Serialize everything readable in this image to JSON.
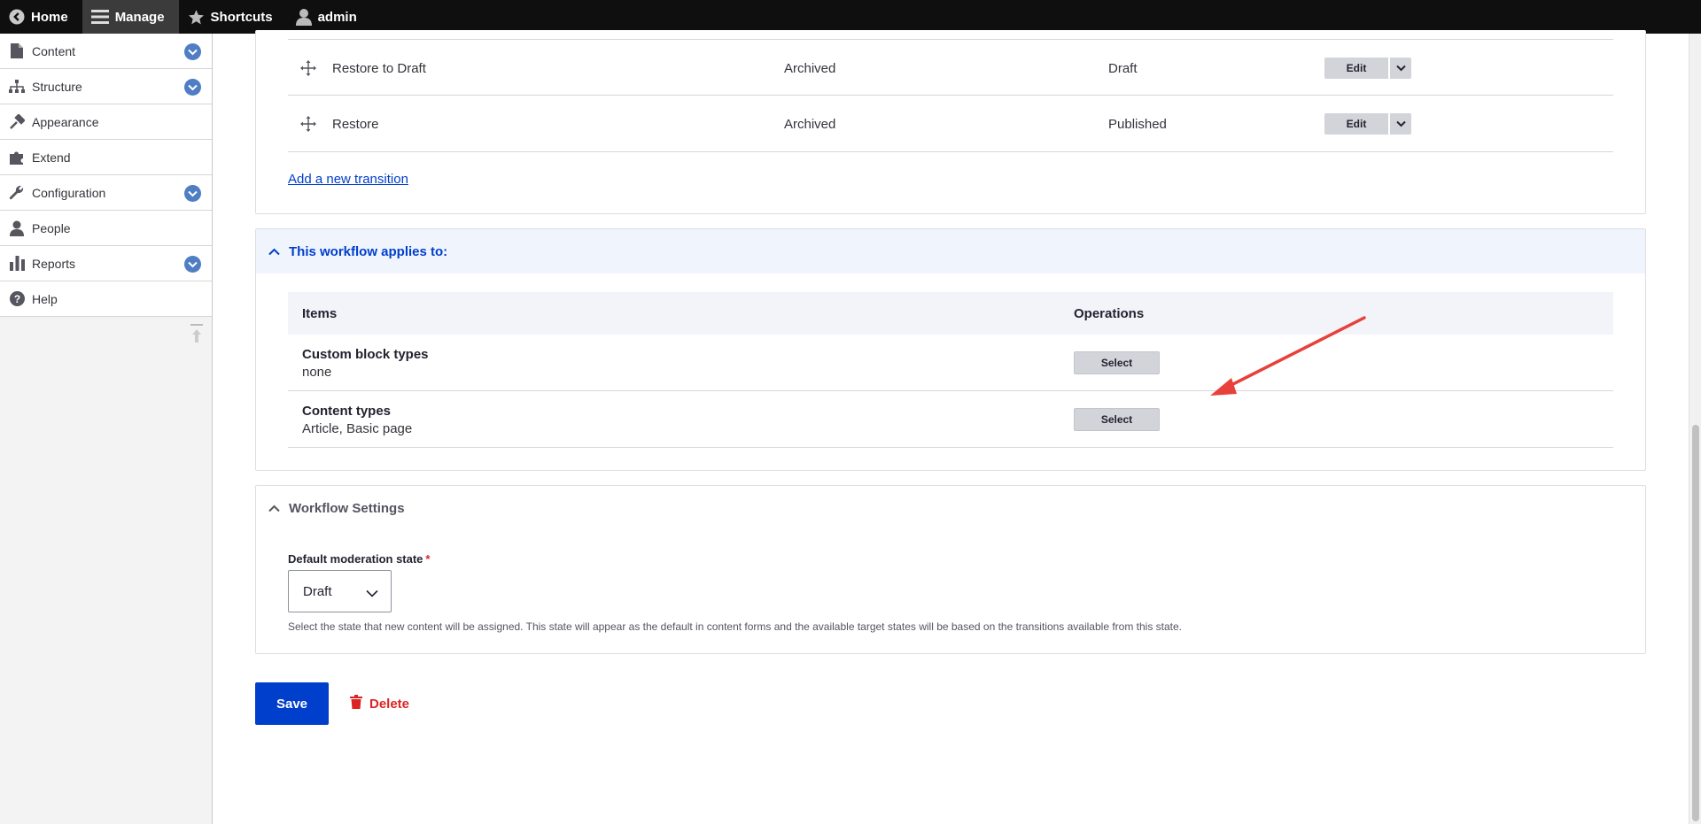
{
  "toolbar": {
    "home": "Home",
    "manage": "Manage",
    "shortcuts": "Shortcuts",
    "user": "admin"
  },
  "sidebar": {
    "items": [
      {
        "label": "Content",
        "icon": "file-icon",
        "expandable": true
      },
      {
        "label": "Structure",
        "icon": "sitemap-icon",
        "expandable": true
      },
      {
        "label": "Appearance",
        "icon": "paintbrush-icon",
        "expandable": false
      },
      {
        "label": "Extend",
        "icon": "puzzle-icon",
        "expandable": false
      },
      {
        "label": "Configuration",
        "icon": "wrench-icon",
        "expandable": true
      },
      {
        "label": "People",
        "icon": "person-icon",
        "expandable": false
      },
      {
        "label": "Reports",
        "icon": "bar-chart-icon",
        "expandable": true
      },
      {
        "label": "Help",
        "icon": "help-icon",
        "expandable": false
      }
    ]
  },
  "transitions": {
    "rows": [
      {
        "label": "Restore to Draft",
        "from": "Archived",
        "to": "Draft",
        "edit": "Edit"
      },
      {
        "label": "Restore",
        "from": "Archived",
        "to": "Published",
        "edit": "Edit"
      }
    ],
    "add_link": "Add a new transition"
  },
  "applies": {
    "summary": "This workflow applies to:",
    "col_items": "Items",
    "col_operations": "Operations",
    "rows": [
      {
        "title": "Custom block types",
        "desc": "none",
        "button": "Select"
      },
      {
        "title": "Content types",
        "desc": "Article, Basic page",
        "button": "Select"
      }
    ]
  },
  "settings": {
    "summary": "Workflow Settings",
    "field_label": "Default moderation state",
    "required_mark": "*",
    "selected": "Draft",
    "description": "Select the state that new content will be assigned. This state will appear as the default in content forms and the available target states will be based on the transitions available from this state."
  },
  "actions": {
    "save": "Save",
    "delete": "Delete"
  },
  "colors": {
    "accent": "#003ecc",
    "danger": "#dc2323",
    "annotation": "#e8403a"
  }
}
